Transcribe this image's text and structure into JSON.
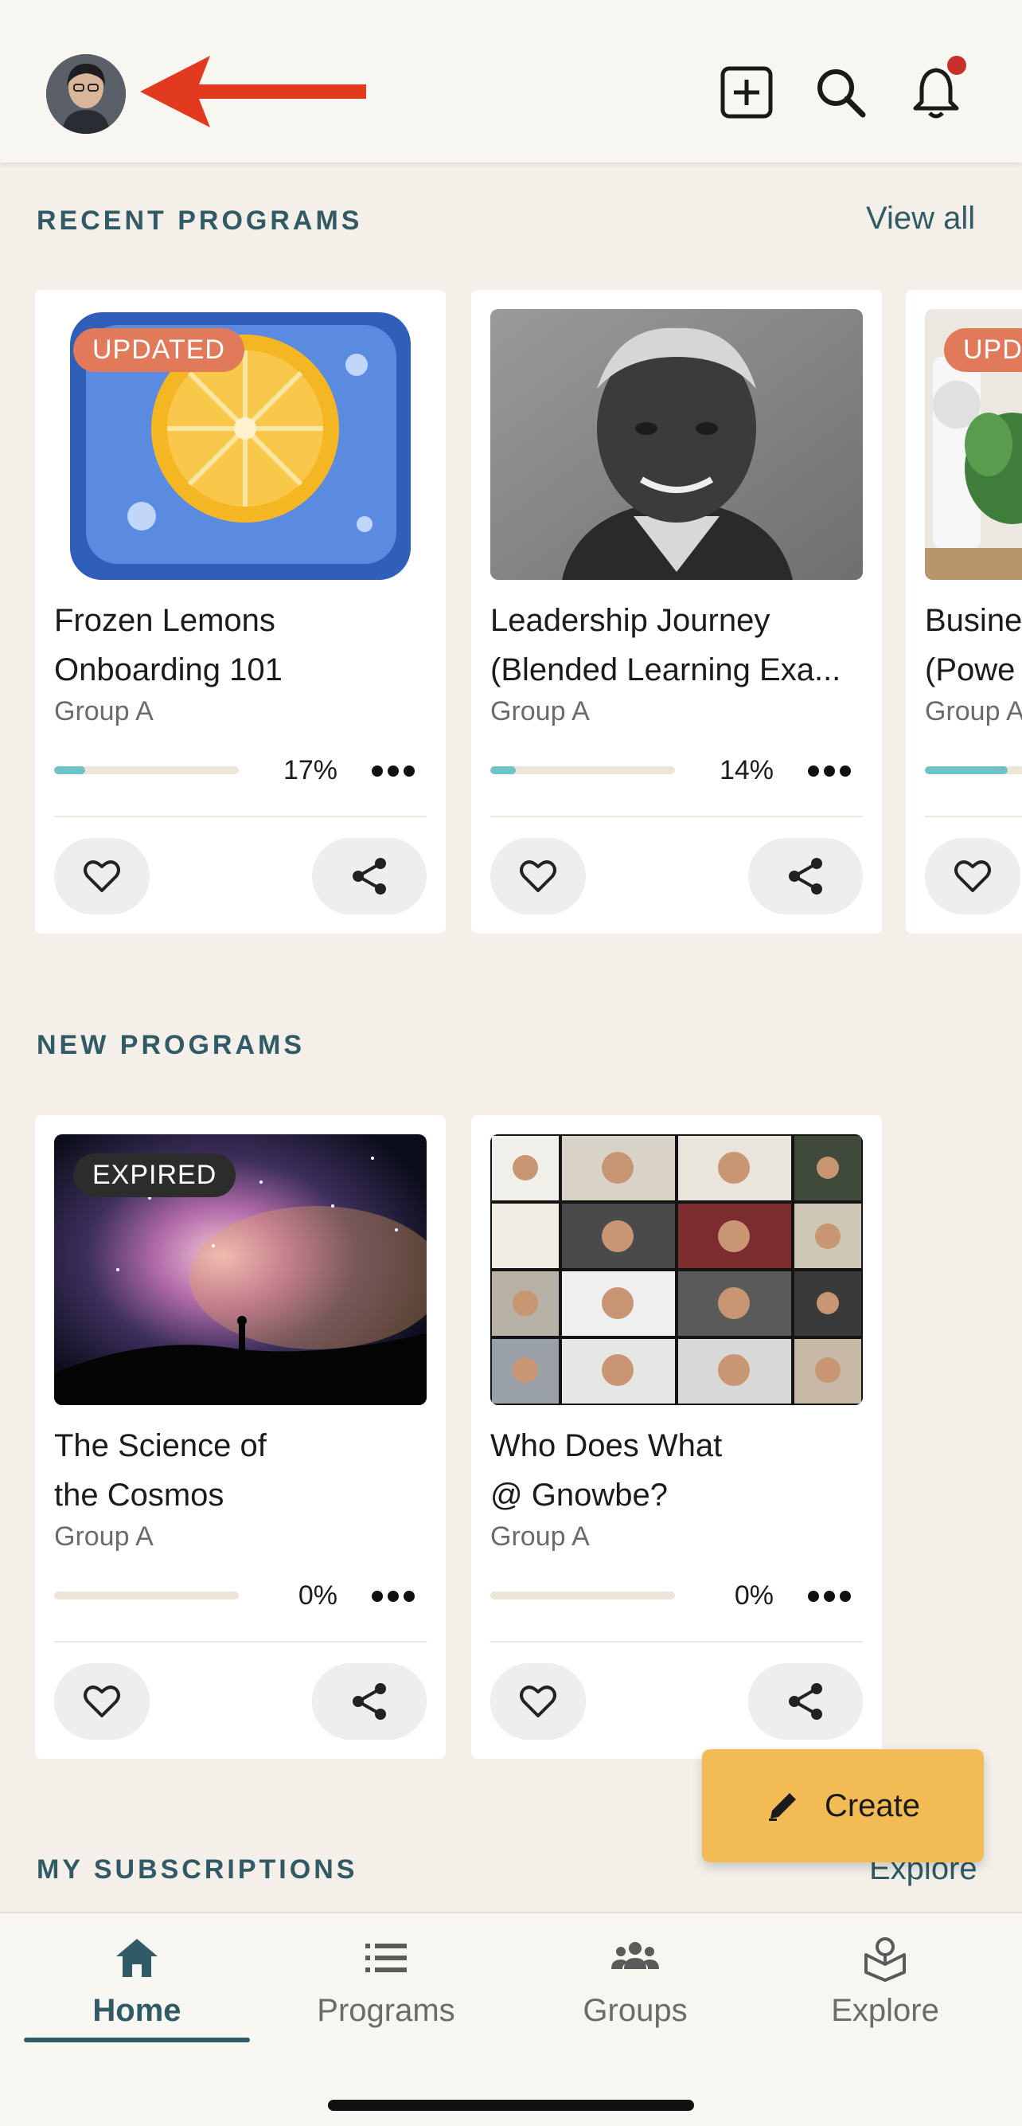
{
  "header": {
    "icons": [
      "avatar",
      "arrow-left-icon",
      "add-square-icon",
      "search-icon",
      "bell-icon"
    ],
    "notification_dot_color": "#c8312a"
  },
  "recent": {
    "title": "RECENT PROGRAMS",
    "link": "View all",
    "cards": [
      {
        "badge": "UPDATED",
        "title_line1": "Frozen Lemons",
        "title_line2": "Onboarding 101",
        "group": "Group A",
        "progress": 17,
        "progress_label": "17%"
      },
      {
        "badge": "",
        "title_line1": "Leadership Journey",
        "title_line2": "(Blended Learning Exa...",
        "group": "Group A",
        "progress": 14,
        "progress_label": "14%"
      },
      {
        "badge": "UPD",
        "title_line1": "Busine",
        "title_line2": "(Powe",
        "group": "Group A",
        "progress": 45,
        "progress_label": ""
      }
    ]
  },
  "new": {
    "title": "NEW PROGRAMS",
    "cards": [
      {
        "badge": "EXPIRED",
        "title_line1": "The Science of",
        "title_line2": "the Cosmos",
        "group": "Group A",
        "progress": 0,
        "progress_label": "0%"
      },
      {
        "badge": "",
        "title_line1": "Who Does What",
        "title_line2": "@ Gnowbe?",
        "group": "Group A",
        "progress": 0,
        "progress_label": "0%"
      }
    ]
  },
  "subscriptions": {
    "title": "MY SUBSCRIPTIONS",
    "link": "Explore"
  },
  "fab": {
    "label": "Create"
  },
  "nav": {
    "items": [
      {
        "label": "Home",
        "icon": "home-icon",
        "active": true
      },
      {
        "label": "Programs",
        "icon": "list-icon",
        "active": false
      },
      {
        "label": "Groups",
        "icon": "groups-icon",
        "active": false
      },
      {
        "label": "Explore",
        "icon": "explore-icon",
        "active": false
      }
    ]
  },
  "colors": {
    "accent": "#2f5a66",
    "progress": "#6fc3c7",
    "updated_badge": "#e17a5a",
    "fab": "#f3bb55"
  }
}
